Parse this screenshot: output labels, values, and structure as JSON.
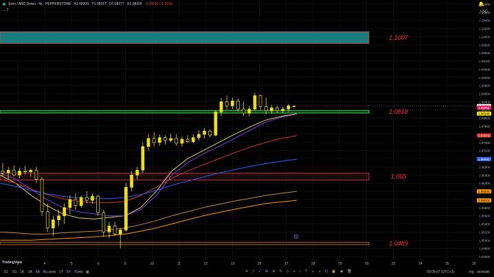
{
  "header": {
    "symbol": "Euro / ABD Doları · 4s · PEPPERSTONE",
    "open": "A1.08309",
    "high": "Y1.08317",
    "low": "D1.08277",
    "close": "K1.08294",
    "change": "-0.00016 (-0.01%)",
    "collapse": "2",
    "currency": "USD"
  },
  "toolbar": {
    "timeframes": [
      "1G",
      "5G",
      "1A",
      "3A",
      "6A",
      "Bu sene",
      "1Y",
      "5Y",
      "Tümü"
    ],
    "clock": "09:09:07 (UTC+3)",
    "log_label": "log",
    "auto_label": "otomatik"
  },
  "logo_text": "TradingView",
  "colors": {
    "background": "#000000",
    "candle": "#f5e100",
    "zone_red_border": "#e0414f",
    "zone_green_border": "#2ad14a",
    "zone_teal": "#1b7e7e",
    "ema_yellow": "#e6d44b",
    "ma_purple": "#7b3cf0",
    "ma_red": "#d2322d",
    "ma_blue": "#2962ff",
    "ma_orange": "#ff9800",
    "ma_tan": "#c68a4a",
    "level_red": "#ff2b2b",
    "grid": "#1a1a1a"
  },
  "chart_data": {
    "type": "candlestick",
    "title": "",
    "price_axis": {
      "ticks": [
        1.046,
        1.048,
        1.05,
        1.052,
        1.054,
        1.056,
        1.058,
        1.06,
        1.062,
        1.064,
        1.066,
        1.068,
        1.07,
        1.072,
        1.074,
        1.076,
        1.078,
        1.08,
        1.082,
        1.084,
        1.086,
        1.088,
        1.09,
        1.092,
        1.094,
        1.096,
        1.098,
        1.1,
        1.102,
        1.104,
        1.106,
        1.108
      ],
      "tick_labels": [
        "1.04600",
        "1.04800",
        "1.05000",
        "1.05200",
        "1.05400",
        "1.05600",
        "1.05800",
        "1.06000",
        "1.06200",
        "1.06400",
        "1.06600",
        "1.06800",
        "1.07000",
        "1.07200",
        "1.07400",
        "1.07600",
        "1.07800",
        "1.08000",
        "1.08200",
        "1.08400",
        "1.08600",
        "1.08800",
        "1.09000",
        "1.09200",
        "1.09400",
        "1.09600",
        "1.09800",
        "1.10000",
        "1.10200",
        "1.10400",
        "1.10600",
        "1.10800"
      ],
      "ylim": [
        1.045,
        1.109
      ],
      "badges": [
        {
          "text": "1.08294",
          "bg": "#ffffff",
          "fg": "#000000",
          "value": 1.08294
        },
        {
          "text": "1.08256",
          "bg": "#e91e63",
          "fg": "#ffffff",
          "value": 1.08256
        },
        {
          "text": "1.08108",
          "bg": "#f5e100",
          "fg": "#000000",
          "value": 1.08108
        },
        {
          "text": "1.07573",
          "bg": "#d2322d",
          "fg": "#ffffff",
          "value": 1.07573
        },
        {
          "text": "1.06993",
          "bg": "#2962ff",
          "fg": "#ffffff",
          "value": 1.06993
        },
        {
          "text": "1.06200",
          "bg": "#ff9800",
          "fg": "#000000",
          "value": 1.062
        },
        {
          "text": "1.05978",
          "bg": "#ff9800",
          "fg": "#000000",
          "value": 1.05978
        }
      ]
    },
    "time_axis": {
      "labels": [
        "3",
        "4",
        "5",
        "6",
        "9",
        "10",
        "11",
        "12",
        "13",
        "16",
        "17",
        "18",
        "19",
        "20",
        "23",
        "24",
        "25",
        "26"
      ]
    },
    "zones": [
      {
        "name": "zone-1-1007",
        "low": 1.0983,
        "high": 1.1012,
        "style": "teal",
        "label": "1.1007"
      },
      {
        "name": "zone-1-0818",
        "low": 1.08125,
        "high": 1.0818,
        "style": "green",
        "label": "1.0818"
      },
      {
        "name": "zone-1-065",
        "low": 1.0648,
        "high": 1.0665,
        "style": "red",
        "label": "1.065"
      },
      {
        "name": "zone-1-0489",
        "low": 1.0489,
        "high": 1.0495,
        "style": "orange",
        "label": "1.0489"
      }
    ],
    "candles": [
      {
        "o": 1.067,
        "h": 1.069,
        "l": 1.0655,
        "c": 1.0665
      },
      {
        "o": 1.0665,
        "h": 1.068,
        "l": 1.065,
        "c": 1.0672
      },
      {
        "o": 1.0672,
        "h": 1.0684,
        "l": 1.0658,
        "c": 1.066
      },
      {
        "o": 1.066,
        "h": 1.0678,
        "l": 1.0652,
        "c": 1.067
      },
      {
        "o": 1.067,
        "h": 1.0682,
        "l": 1.0662,
        "c": 1.0668
      },
      {
        "o": 1.0668,
        "h": 1.0676,
        "l": 1.0656,
        "c": 1.0672
      },
      {
        "o": 1.0672,
        "h": 1.068,
        "l": 1.064,
        "c": 1.065
      },
      {
        "o": 1.065,
        "h": 1.0655,
        "l": 1.056,
        "c": 1.057
      },
      {
        "o": 1.057,
        "h": 1.059,
        "l": 1.052,
        "c": 1.053
      },
      {
        "o": 1.053,
        "h": 1.056,
        "l": 1.051,
        "c": 1.055
      },
      {
        "o": 1.055,
        "h": 1.0575,
        "l": 1.0535,
        "c": 1.056
      },
      {
        "o": 1.056,
        "h": 1.059,
        "l": 1.054,
        "c": 1.058
      },
      {
        "o": 1.058,
        "h": 1.061,
        "l": 1.0565,
        "c": 1.06
      },
      {
        "o": 1.06,
        "h": 1.0615,
        "l": 1.0575,
        "c": 1.0585
      },
      {
        "o": 1.0585,
        "h": 1.061,
        "l": 1.058,
        "c": 1.0605
      },
      {
        "o": 1.0605,
        "h": 1.062,
        "l": 1.059,
        "c": 1.0598
      },
      {
        "o": 1.0598,
        "h": 1.0615,
        "l": 1.059,
        "c": 1.0608
      },
      {
        "o": 1.0608,
        "h": 1.0612,
        "l": 1.056,
        "c": 1.0568
      },
      {
        "o": 1.0568,
        "h": 1.0575,
        "l": 1.051,
        "c": 1.052
      },
      {
        "o": 1.052,
        "h": 1.0545,
        "l": 1.0505,
        "c": 1.0535
      },
      {
        "o": 1.0535,
        "h": 1.0545,
        "l": 1.051,
        "c": 1.0515
      },
      {
        "o": 1.0515,
        "h": 1.053,
        "l": 1.048,
        "c": 1.0525
      },
      {
        "o": 1.0525,
        "h": 1.064,
        "l": 1.052,
        "c": 1.063
      },
      {
        "o": 1.063,
        "h": 1.067,
        "l": 1.062,
        "c": 1.066
      },
      {
        "o": 1.066,
        "h": 1.068,
        "l": 1.065,
        "c": 1.0672
      },
      {
        "o": 1.0672,
        "h": 1.074,
        "l": 1.0665,
        "c": 1.073
      },
      {
        "o": 1.073,
        "h": 1.076,
        "l": 1.072,
        "c": 1.075
      },
      {
        "o": 1.075,
        "h": 1.0765,
        "l": 1.073,
        "c": 1.074
      },
      {
        "o": 1.074,
        "h": 1.076,
        "l": 1.0732,
        "c": 1.0752
      },
      {
        "o": 1.0752,
        "h": 1.0758,
        "l": 1.0735,
        "c": 1.0745
      },
      {
        "o": 1.0745,
        "h": 1.0762,
        "l": 1.074,
        "c": 1.075
      },
      {
        "o": 1.075,
        "h": 1.076,
        "l": 1.0732,
        "c": 1.0738
      },
      {
        "o": 1.0738,
        "h": 1.0755,
        "l": 1.073,
        "c": 1.0748
      },
      {
        "o": 1.0748,
        "h": 1.0758,
        "l": 1.0738,
        "c": 1.0742
      },
      {
        "o": 1.0742,
        "h": 1.076,
        "l": 1.0738,
        "c": 1.0752
      },
      {
        "o": 1.0752,
        "h": 1.077,
        "l": 1.0745,
        "c": 1.076
      },
      {
        "o": 1.076,
        "h": 1.0775,
        "l": 1.075,
        "c": 1.0768
      },
      {
        "o": 1.0768,
        "h": 1.0772,
        "l": 1.0752,
        "c": 1.0758
      },
      {
        "o": 1.0758,
        "h": 1.082,
        "l": 1.0755,
        "c": 1.0815
      },
      {
        "o": 1.0815,
        "h": 1.085,
        "l": 1.0805,
        "c": 1.084
      },
      {
        "o": 1.084,
        "h": 1.0855,
        "l": 1.082,
        "c": 1.083
      },
      {
        "o": 1.083,
        "h": 1.085,
        "l": 1.0822,
        "c": 1.0842
      },
      {
        "o": 1.0842,
        "h": 1.0848,
        "l": 1.0815,
        "c": 1.0822
      },
      {
        "o": 1.0822,
        "h": 1.084,
        "l": 1.0805,
        "c": 1.0812
      },
      {
        "o": 1.0812,
        "h": 1.083,
        "l": 1.0805,
        "c": 1.0822
      },
      {
        "o": 1.0822,
        "h": 1.0862,
        "l": 1.0818,
        "c": 1.0855
      },
      {
        "o": 1.0855,
        "h": 1.0858,
        "l": 1.082,
        "c": 1.0828
      },
      {
        "o": 1.0828,
        "h": 1.085,
        "l": 1.081,
        "c": 1.0818
      },
      {
        "o": 1.0818,
        "h": 1.0832,
        "l": 1.081,
        "c": 1.0825
      },
      {
        "o": 1.0825,
        "h": 1.083,
        "l": 1.0812,
        "c": 1.0818
      },
      {
        "o": 1.0818,
        "h": 1.0828,
        "l": 1.0812,
        "c": 1.0822
      },
      {
        "o": 1.0822,
        "h": 1.0835,
        "l": 1.0815,
        "c": 1.083
      },
      {
        "o": 1.083,
        "h": 1.0832,
        "l": 1.0827,
        "c": 1.0829
      }
    ],
    "moving_averages": [
      {
        "name": "ema-yellow",
        "color": "#e6d44b",
        "points": [
          1.066,
          1.064,
          1.061,
          1.0585,
          1.0565,
          1.0555,
          1.0552,
          1.0556,
          1.056,
          1.058,
          1.062,
          1.067,
          1.07,
          1.072,
          1.074,
          1.076,
          1.0778,
          1.0795,
          1.0804,
          1.0811
        ]
      },
      {
        "name": "ma-purple",
        "color": "#7b3cf0",
        "points": [
          1.0665,
          1.065,
          1.0625,
          1.06,
          1.058,
          1.057,
          1.0565,
          1.056,
          1.056,
          1.0575,
          1.061,
          1.066,
          1.069,
          1.0712,
          1.073,
          1.075,
          1.077,
          1.079,
          1.0802,
          1.081
        ]
      },
      {
        "name": "ma-red",
        "color": "#d2322d",
        "points": [
          1.065,
          1.064,
          1.0625,
          1.0612,
          1.0602,
          1.0595,
          1.0592,
          1.0592,
          1.0595,
          1.061,
          1.063,
          1.0652,
          1.067,
          1.0685,
          1.07,
          1.0715,
          1.0728,
          1.074,
          1.075,
          1.0757
        ]
      },
      {
        "name": "ma-blue",
        "color": "#2962ff",
        "points": [
          1.064,
          1.0632,
          1.0622,
          1.0614,
          1.0608,
          1.0604,
          1.0602,
          1.0602,
          1.0605,
          1.0612,
          1.0622,
          1.0635,
          1.0645,
          1.0655,
          1.0665,
          1.0673,
          1.0681,
          1.0688,
          1.0694,
          1.0699
        ]
      },
      {
        "name": "ma-tan",
        "color": "#c68a4a",
        "points": [
          1.052,
          1.0518,
          1.0515,
          1.0515,
          1.0518,
          1.052,
          1.0522,
          1.0525,
          1.053,
          1.0538,
          1.0548,
          1.056,
          1.057,
          1.058,
          1.0588,
          1.0596,
          1.0603,
          1.061,
          1.0615,
          1.062
        ]
      },
      {
        "name": "ma-orange",
        "color": "#ff9800",
        "points": [
          1.05,
          1.05,
          1.05,
          1.0502,
          1.0504,
          1.0506,
          1.0508,
          1.0511,
          1.0515,
          1.0522,
          1.053,
          1.054,
          1.055,
          1.056,
          1.0568,
          1.0576,
          1.0583,
          1.059,
          1.0594,
          1.0598
        ]
      }
    ]
  }
}
